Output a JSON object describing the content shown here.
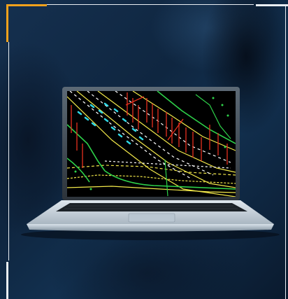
{
  "scene": {
    "description_free": true,
    "background_color": "#12304f",
    "accent_color": "#f4a21c",
    "frame_color": "#e9eef3",
    "laptop_color": "#c9d6e0",
    "screen_background": "#000000",
    "drawing_colors": [
      "#f2e84a",
      "#e8301e",
      "#2ed24a",
      "#2fd8e6",
      "#ffffff"
    ]
  }
}
